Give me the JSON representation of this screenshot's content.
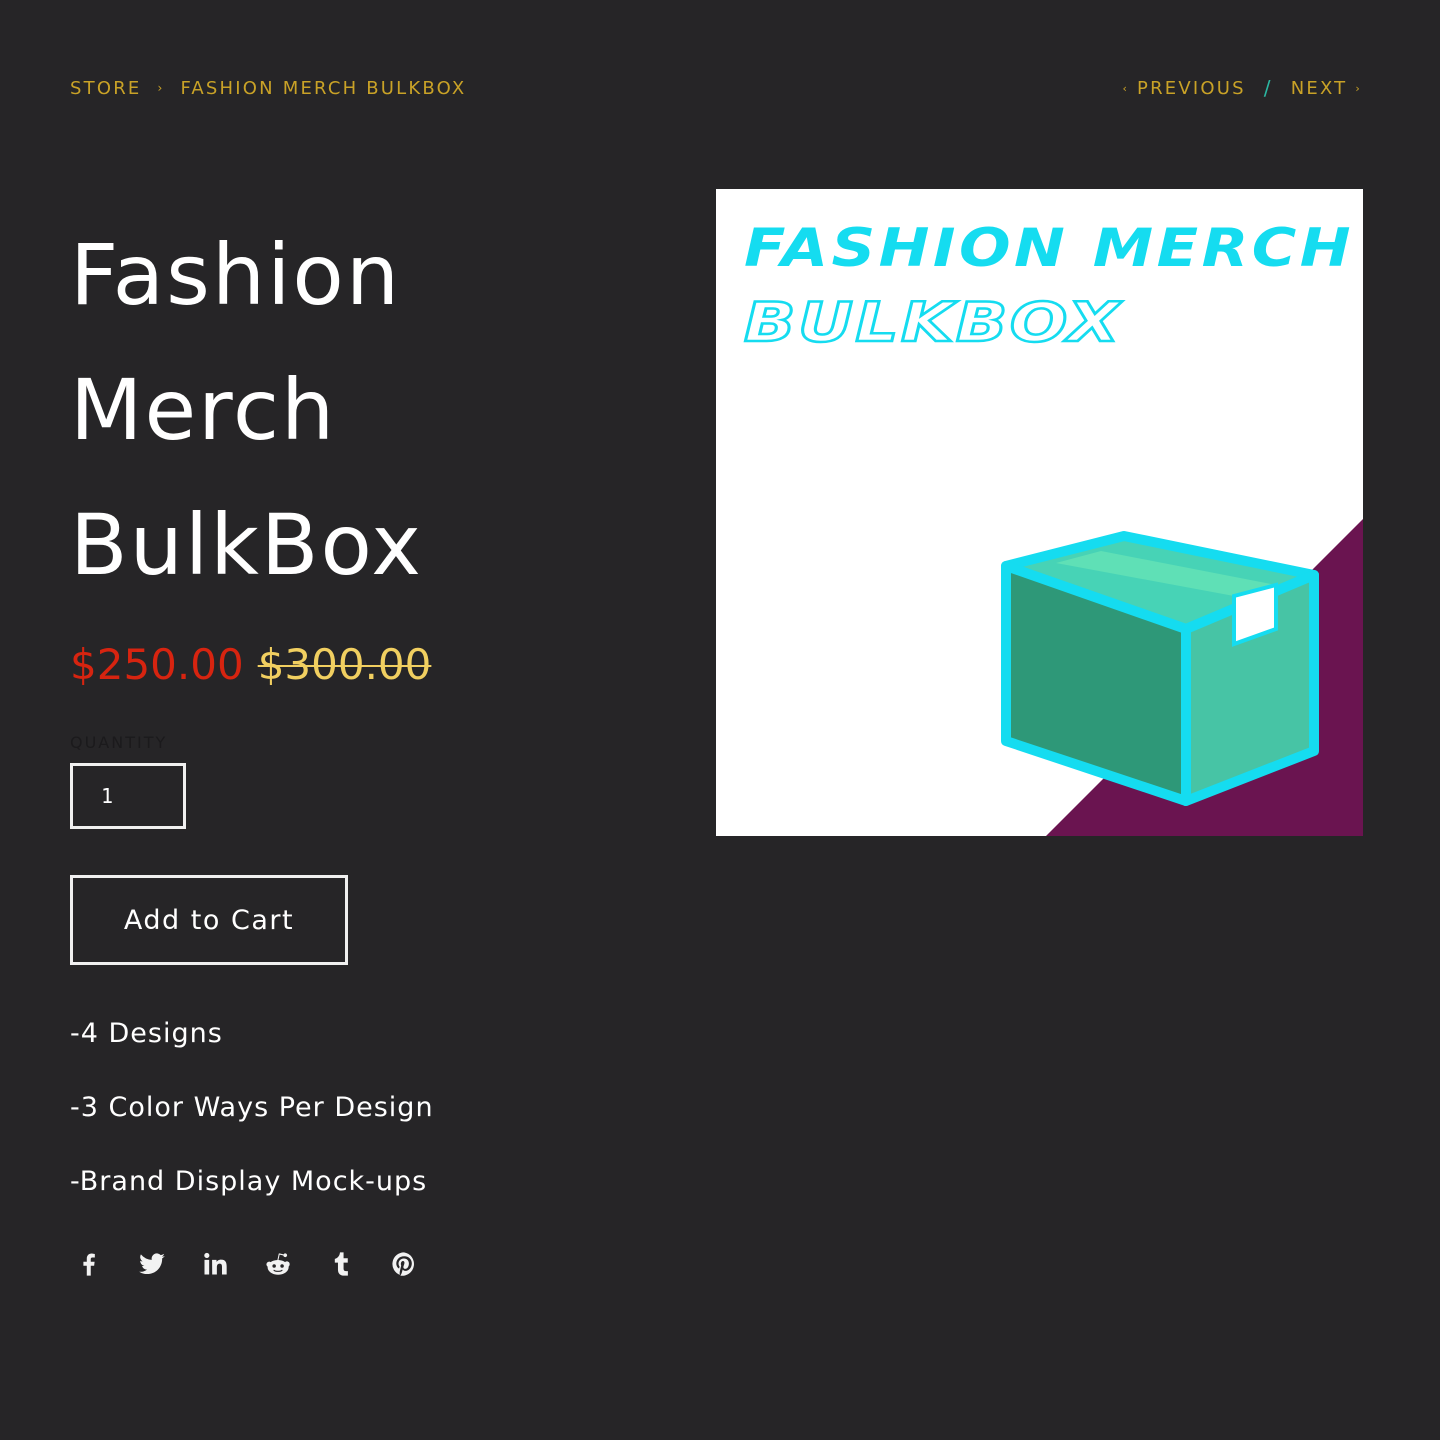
{
  "breadcrumb": {
    "store": "STORE",
    "separator": "›",
    "current": "FASHION MERCH BULKBOX"
  },
  "pagination": {
    "prev_arrow": "‹",
    "previous": "PREVIOUS",
    "divider": "/",
    "next": "NEXT",
    "next_arrow": "›"
  },
  "product": {
    "title_lines": [
      "Fashion",
      "Merch",
      "BulkBox"
    ],
    "price_sale": "$250.00",
    "price_original": "$300.00",
    "quantity_label": "QUANTITY",
    "quantity_value": "1",
    "add_to_cart": "Add to Cart",
    "description": [
      "-4 Designs",
      "-3 Color Ways Per Design",
      "-Brand Display Mock-ups"
    ],
    "image": {
      "line1": "FASHION MERCH",
      "line2": "BULKBOX"
    }
  },
  "share_icons": [
    "facebook-icon",
    "twitter-icon",
    "linkedin-icon",
    "reddit-icon",
    "tumblr-icon",
    "pinterest-icon"
  ],
  "colors": {
    "background": "#262527",
    "accent_gold": "#c9a227",
    "sale_red": "#d72410",
    "original_price": "#f1cf60",
    "image_cyan": "#15dcf0",
    "image_purple": "#6a1450",
    "box_green": "#2e9878"
  }
}
